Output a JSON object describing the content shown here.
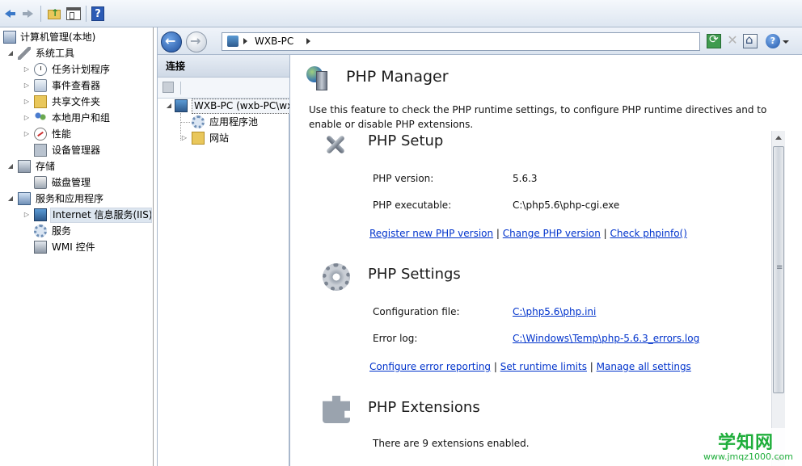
{
  "left_tree": {
    "root": "计算机管理(本地)",
    "system_tools": "系统工具",
    "task_scheduler": "任务计划程序",
    "event_viewer": "事件查看器",
    "shared_folders": "共享文件夹",
    "local_users": "本地用户和组",
    "performance": "性能",
    "device_manager": "设备管理器",
    "storage": "存储",
    "disk_management": "磁盘管理",
    "services_apps": "服务和应用程序",
    "iis": "Internet 信息服务(IIS)管",
    "services": "服务",
    "wmi": "WMI 控件"
  },
  "address_bar": {
    "path": "WXB-PC"
  },
  "connections": {
    "header": "连接",
    "server": "WXB-PC (wxb-PC\\wx",
    "app_pools": "应用程序池",
    "sites": "网站"
  },
  "main": {
    "title": "PHP Manager",
    "description": "Use this feature to check the PHP runtime settings, to configure PHP runtime directives and to enable or disable PHP extensions.",
    "setup": {
      "title": "PHP Setup",
      "version_label": "PHP version:",
      "version_value": "5.6.3",
      "exe_label": "PHP executable:",
      "exe_value": "C:\\php5.6\\php-cgi.exe",
      "link_register": "Register new PHP version",
      "link_change": "Change PHP version",
      "link_phpinfo": "Check phpinfo()",
      "sep": " | "
    },
    "settings": {
      "title": "PHP Settings",
      "config_label": "Configuration file:",
      "config_value": "C:\\php5.6\\php.ini",
      "errorlog_label": "Error log:",
      "errorlog_value": "C:\\Windows\\Temp\\php-5.6.3_errors.log",
      "link_error_reporting": "Configure error reporting",
      "link_runtime_limits": "Set runtime limits",
      "link_manage_all": "Manage all settings"
    },
    "extensions": {
      "title": "PHP Extensions",
      "text": "There are 9 extensions enabled."
    }
  },
  "watermark": {
    "big": "学知网",
    "small": "www.jmqz1000.com"
  },
  "colors": {
    "link": "#0033cc",
    "watermark": "#1fae3b",
    "selection": "#dde6f0"
  }
}
